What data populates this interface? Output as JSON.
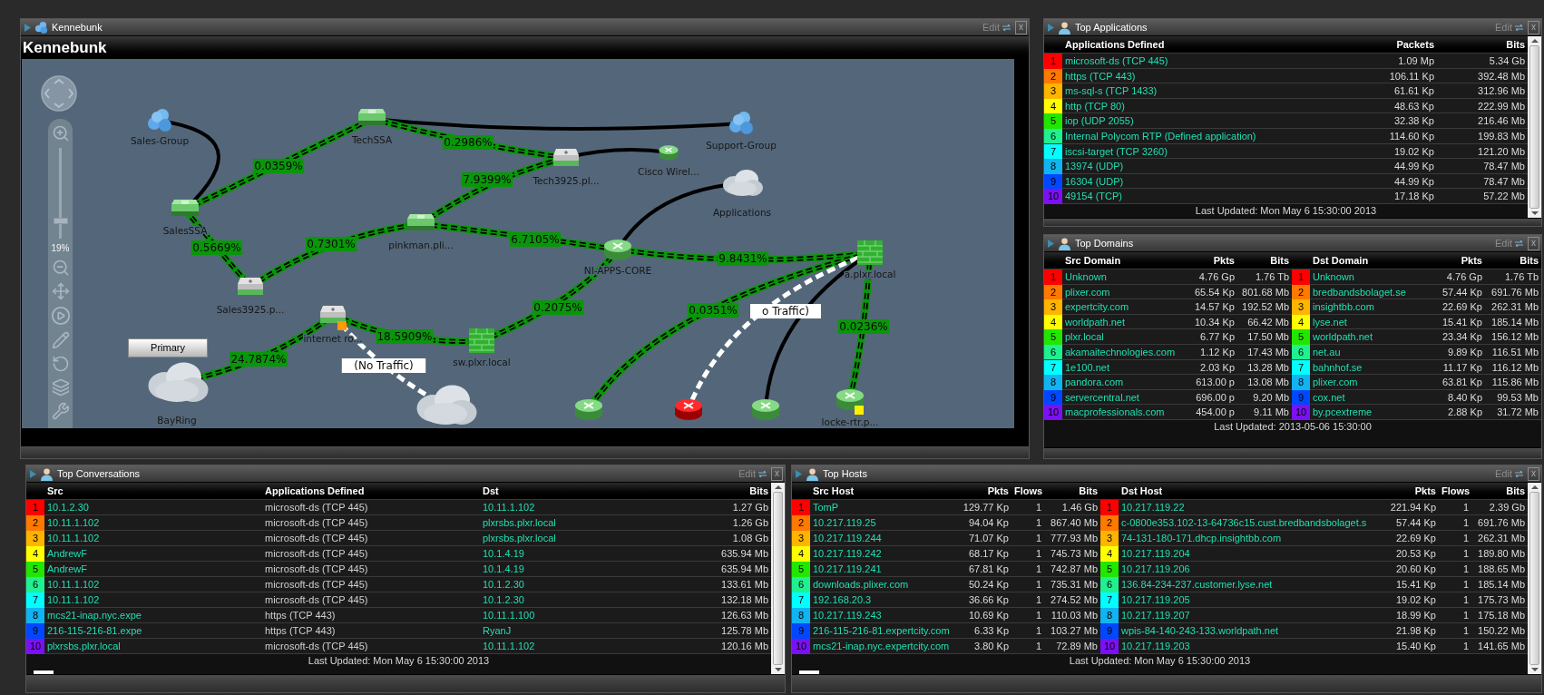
{
  "map_panel": {
    "title": "Kennebunk",
    "edit": "Edit",
    "close": "x",
    "heading": "Kennebunk",
    "zoom": {
      "level": 0.19,
      "reading": "19%"
    },
    "primary_button": "Primary",
    "nodes": [
      {
        "name": "Sales-Group",
        "kind": "group"
      },
      {
        "name": "TechSSA",
        "kind": "switch"
      },
      {
        "name": "Support-Group",
        "kind": "group"
      },
      {
        "name": "Tech3925.pl...",
        "kind": "appliance"
      },
      {
        "name": "Cisco Wirel...",
        "kind": "router",
        "down": false
      },
      {
        "name": "Applications",
        "kind": "cloud"
      },
      {
        "name": "SalesSSA",
        "kind": "switch"
      },
      {
        "name": "pinkman.pli...",
        "kind": "switch"
      },
      {
        "name": "NI-APPS-CORE",
        "kind": "router",
        "down": false
      },
      {
        "name": "a.plxr.local",
        "kind": "firewall"
      },
      {
        "name": "Sales3925.p...",
        "kind": "appliance"
      },
      {
        "name": "internet ro...",
        "kind": "appliance",
        "color": "#ff9900"
      },
      {
        "name": "sw.plxr.local",
        "kind": "firewall"
      },
      {
        "name": "BayRing",
        "kind": "cloud"
      },
      {
        "kind": "cloud"
      },
      {
        "kind": "router",
        "down": false
      },
      {
        "kind": "router",
        "down": true
      },
      {
        "kind": "router",
        "down": false
      },
      {
        "name": "locke-rtr.p...",
        "kind": "router",
        "down": false,
        "color": "#ffee00"
      }
    ],
    "links": [
      {
        "kind": "plain"
      },
      {
        "kind": "traffic",
        "label": "0.0359%"
      },
      {
        "kind": "plain"
      },
      {
        "kind": "traffic",
        "label": "0.2986%"
      },
      {
        "kind": "plain"
      },
      {
        "kind": "traffic",
        "label": "7.9399%"
      },
      {
        "kind": "traffic",
        "label": "0.5669%"
      },
      {
        "kind": "traffic",
        "label": "0.7301%"
      },
      {
        "kind": "traffic",
        "label": "6.7105%"
      },
      {
        "kind": "plain"
      },
      {
        "kind": "traffic",
        "label": "9.8431%"
      },
      {
        "kind": "traffic",
        "label": "0.2075%"
      },
      {
        "kind": "traffic",
        "label": "18.5909%"
      },
      {
        "kind": "traffic",
        "label": "24.7874%"
      },
      {
        "kind": "none",
        "label": "(No Traffic)"
      },
      {
        "kind": "traffic",
        "label": "0.0351%"
      },
      {
        "kind": "none",
        "label": "o Traffic)"
      },
      {
        "kind": "plain"
      },
      {
        "kind": "traffic",
        "label": "0.0236%"
      }
    ]
  },
  "top_applications": {
    "title": "Top Applications",
    "edit": "Edit",
    "close": "x",
    "columns": [
      "Applications Defined",
      "Packets",
      "Bits"
    ],
    "rows": [
      {
        "rank": "1",
        "color": "#ff0000",
        "name": "microsoft-ds (TCP 445)",
        "packets": "1.09 Mp",
        "bits": "5.34 Gb"
      },
      {
        "rank": "2",
        "color": "#ff7800",
        "name": "https (TCP 443)",
        "packets": "106.11 Kp",
        "bits": "392.48 Mb"
      },
      {
        "rank": "3",
        "color": "#ffb400",
        "name": "ms-sql-s (TCP 1433)",
        "packets": "61.61 Kp",
        "bits": "312.96 Mb"
      },
      {
        "rank": "4",
        "color": "#ffff00",
        "name": "http (TCP 80)",
        "packets": "48.63 Kp",
        "bits": "222.99 Mb"
      },
      {
        "rank": "5",
        "color": "#22e600",
        "name": "iop (UDP 2055)",
        "packets": "32.38 Kp",
        "bits": "216.46 Mb"
      },
      {
        "rank": "6",
        "color": "#20f090",
        "name": "Internal Polycom RTP (Defined application)",
        "packets": "114.60 Kp",
        "bits": "199.83 Mb"
      },
      {
        "rank": "7",
        "color": "#00ffff",
        "name": "iscsi-target (TCP 3260)",
        "packets": "19.02 Kp",
        "bits": "121.20 Mb"
      },
      {
        "rank": "8",
        "color": "#10b4f0",
        "name": "13974 (UDP)",
        "packets": "44.99 Kp",
        "bits": "78.47 Mb"
      },
      {
        "rank": "9",
        "color": "#0048ff",
        "name": "16304 (UDP)",
        "packets": "44.99 Kp",
        "bits": "78.47 Mb"
      },
      {
        "rank": "10",
        "color": "#7c10f4",
        "name": "49154 (TCP)",
        "packets": "17.18 Kp",
        "bits": "57.22 Mb"
      }
    ],
    "footer": "Last Updated: Mon May 6 15:30:00 2013"
  },
  "top_domains": {
    "title": "Top Domains",
    "edit": "Edit",
    "close": "x",
    "columns": [
      "Src Domain",
      "Pkts",
      "Bits",
      "Dst Domain",
      "Pkts",
      "Bits"
    ],
    "rows": [
      {
        "src": {
          "rank": "1",
          "color": "#ff0000",
          "domain": "Unknown",
          "pkts": "4.76 Gp",
          "bits": "1.76 Tb"
        },
        "dst": {
          "rank": "1",
          "color": "#ff0000",
          "domain": "Unknown",
          "pkts": "4.76 Gp",
          "bits": "1.76 Tb"
        }
      },
      {
        "src": {
          "rank": "2",
          "color": "#ff7800",
          "domain": "plixer.com",
          "pkts": "65.54 Kp",
          "bits": "801.68 Mb"
        },
        "dst": {
          "rank": "2",
          "color": "#ff7800",
          "domain": "bredbandsbolaget.se",
          "pkts": "57.44 Kp",
          "bits": "691.76 Mb"
        }
      },
      {
        "src": {
          "rank": "3",
          "color": "#ffb400",
          "domain": "expertcity.com",
          "pkts": "14.57 Kp",
          "bits": "192.52 Mb"
        },
        "dst": {
          "rank": "3",
          "color": "#ffb400",
          "domain": "insightbb.com",
          "pkts": "22.69 Kp",
          "bits": "262.31 Mb"
        }
      },
      {
        "src": {
          "rank": "4",
          "color": "#ffff00",
          "domain": "worldpath.net",
          "pkts": "10.34 Kp",
          "bits": "66.42 Mb"
        },
        "dst": {
          "rank": "4",
          "color": "#ffff00",
          "domain": "lyse.net",
          "pkts": "15.41 Kp",
          "bits": "185.14 Mb"
        }
      },
      {
        "src": {
          "rank": "5",
          "color": "#22e600",
          "domain": "plxr.local",
          "pkts": "6.77 Kp",
          "bits": "17.50 Mb"
        },
        "dst": {
          "rank": "5",
          "color": "#22e600",
          "domain": "worldpath.net",
          "pkts": "23.34 Kp",
          "bits": "156.12 Mb"
        }
      },
      {
        "src": {
          "rank": "6",
          "color": "#20f090",
          "domain": "akamaitechnologies.com",
          "pkts": "1.12 Kp",
          "bits": "17.43 Mb"
        },
        "dst": {
          "rank": "6",
          "color": "#20f090",
          "domain": "net.au",
          "pkts": "9.89 Kp",
          "bits": "116.51 Mb"
        }
      },
      {
        "src": {
          "rank": "7",
          "color": "#00ffff",
          "domain": "1e100.net",
          "pkts": "2.03 Kp",
          "bits": "13.28 Mb"
        },
        "dst": {
          "rank": "7",
          "color": "#00ffff",
          "domain": "bahnhof.se",
          "pkts": "11.17 Kp",
          "bits": "116.12 Mb"
        }
      },
      {
        "src": {
          "rank": "8",
          "color": "#10b4f0",
          "domain": "pandora.com",
          "pkts": "613.00 p",
          "bits": "13.08 Mb"
        },
        "dst": {
          "rank": "8",
          "color": "#10b4f0",
          "domain": "plixer.com",
          "pkts": "63.81 Kp",
          "bits": "115.86 Mb"
        }
      },
      {
        "src": {
          "rank": "9",
          "color": "#0048ff",
          "domain": "servercentral.net",
          "pkts": "696.00 p",
          "bits": "9.20 Mb"
        },
        "dst": {
          "rank": "9",
          "color": "#0048ff",
          "domain": "cox.net",
          "pkts": "8.40 Kp",
          "bits": "99.53 Mb"
        }
      },
      {
        "src": {
          "rank": "10",
          "color": "#7c10f4",
          "domain": "macprofessionals.com",
          "pkts": "454.00 p",
          "bits": "9.11 Mb"
        },
        "dst": {
          "rank": "10",
          "color": "#7c10f4",
          "domain": "by.pcextreme",
          "pkts": "2.88 Kp",
          "bits": "31.72 Mb"
        }
      }
    ],
    "footer": "Last Updated: 2013-05-06 15:30:00"
  },
  "top_conversations": {
    "title": "Top Conversations",
    "edit": "Edit",
    "close": "x",
    "columns": [
      "Src",
      "Applications Defined",
      "Dst",
      "Bits"
    ],
    "rows": [
      {
        "rank": "1",
        "color": "#ff0000",
        "src": "10.1.2.30",
        "application": "microsoft-ds (TCP 445)",
        "dst": "10.11.1.102",
        "bits": "1.27 Gb"
      },
      {
        "rank": "2",
        "color": "#ff7800",
        "src": "10.11.1.102",
        "application": "microsoft-ds (TCP 445)",
        "dst": "plxrsbs.plxr.local",
        "bits": "1.26 Gb"
      },
      {
        "rank": "3",
        "color": "#ffb400",
        "src": "10.11.1.102",
        "application": "microsoft-ds (TCP 445)",
        "dst": "plxrsbs.plxr.local",
        "bits": "1.08 Gb"
      },
      {
        "rank": "4",
        "color": "#ffff00",
        "src": "AndrewF",
        "application": "microsoft-ds (TCP 445)",
        "dst": "10.1.4.19",
        "bits": "635.94 Mb"
      },
      {
        "rank": "5",
        "color": "#22e600",
        "src": "AndrewF",
        "application": "microsoft-ds (TCP 445)",
        "dst": "10.1.4.19",
        "bits": "635.94 Mb"
      },
      {
        "rank": "6",
        "color": "#20f090",
        "src": "10.11.1.102",
        "application": "microsoft-ds (TCP 445)",
        "dst": "10.1.2.30",
        "bits": "133.61 Mb"
      },
      {
        "rank": "7",
        "color": "#00ffff",
        "src": "10.11.1.102",
        "application": "microsoft-ds (TCP 445)",
        "dst": "10.1.2.30",
        "bits": "132.18 Mb"
      },
      {
        "rank": "8",
        "color": "#10b4f0",
        "src": "mcs21-inap.nyc.expe",
        "application": "https (TCP 443)",
        "dst": "10.11.1.100",
        "bits": "126.63 Mb"
      },
      {
        "rank": "9",
        "color": "#0048ff",
        "src": "216-115-216-81.expe",
        "application": "https (TCP 443)",
        "dst": "RyanJ",
        "bits": "125.78 Mb"
      },
      {
        "rank": "10",
        "color": "#7c10f4",
        "src": "plxrsbs.plxr.local",
        "application": "microsoft-ds (TCP 445)",
        "dst": "10.11.1.102",
        "bits": "120.16 Mb"
      }
    ],
    "footer": "Last Updated: Mon May 6 15:30:00 2013"
  },
  "top_hosts": {
    "title": "Top Hosts",
    "edit": "Edit",
    "close": "x",
    "columns": [
      "Src Host",
      "Pkts",
      "Flows",
      "Bits",
      "Dst Host",
      "Pkts",
      "Flows",
      "Bits"
    ],
    "rows": [
      {
        "src": {
          "rank": "1",
          "color": "#ff0000",
          "host": "TomP",
          "pkts": "129.77 Kp",
          "flows": "1",
          "bits": "1.46 Gb"
        },
        "dst": {
          "rank": "1",
          "color": "#ff0000",
          "host": "10.217.119.22",
          "pkts": "221.94 Kp",
          "flows": "1",
          "bits": "2.39 Gb"
        }
      },
      {
        "src": {
          "rank": "2",
          "color": "#ff7800",
          "host": "10.217.119.25",
          "pkts": "94.04 Kp",
          "flows": "1",
          "bits": "867.40 Mb"
        },
        "dst": {
          "rank": "2",
          "color": "#ff7800",
          "host": "c-0800e353.102-13-64736c15.cust.bredbandsbolaget.s",
          "pkts": "57.44 Kp",
          "flows": "1",
          "bits": "691.76 Mb"
        }
      },
      {
        "src": {
          "rank": "3",
          "color": "#ffb400",
          "host": "10.217.119.244",
          "pkts": "71.07 Kp",
          "flows": "1",
          "bits": "777.93 Mb"
        },
        "dst": {
          "rank": "3",
          "color": "#ffb400",
          "host": "74-131-180-171.dhcp.insightbb.com",
          "pkts": "22.69 Kp",
          "flows": "1",
          "bits": "262.31 Mb"
        }
      },
      {
        "src": {
          "rank": "4",
          "color": "#ffff00",
          "host": "10.217.119.242",
          "pkts": "68.17 Kp",
          "flows": "1",
          "bits": "745.73 Mb"
        },
        "dst": {
          "rank": "4",
          "color": "#ffff00",
          "host": "10.217.119.204",
          "pkts": "20.53 Kp",
          "flows": "1",
          "bits": "189.80 Mb"
        }
      },
      {
        "src": {
          "rank": "5",
          "color": "#22e600",
          "host": "10.217.119.241",
          "pkts": "67.81 Kp",
          "flows": "1",
          "bits": "742.87 Mb"
        },
        "dst": {
          "rank": "5",
          "color": "#22e600",
          "host": "10.217.119.206",
          "pkts": "20.60 Kp",
          "flows": "1",
          "bits": "188.65 Mb"
        }
      },
      {
        "src": {
          "rank": "6",
          "color": "#20f090",
          "host": "downloads.plixer.com",
          "pkts": "50.24 Kp",
          "flows": "1",
          "bits": "735.31 Mb"
        },
        "dst": {
          "rank": "6",
          "color": "#20f090",
          "host": "136.84-234-237.customer.lyse.net",
          "pkts": "15.41 Kp",
          "flows": "1",
          "bits": "185.14 Mb"
        }
      },
      {
        "src": {
          "rank": "7",
          "color": "#00ffff",
          "host": "192.168.20.3",
          "pkts": "36.66 Kp",
          "flows": "1",
          "bits": "274.52 Mb"
        },
        "dst": {
          "rank": "7",
          "color": "#00ffff",
          "host": "10.217.119.205",
          "pkts": "19.02 Kp",
          "flows": "1",
          "bits": "175.73 Mb"
        }
      },
      {
        "src": {
          "rank": "8",
          "color": "#10b4f0",
          "host": "10.217.119.243",
          "pkts": "10.69 Kp",
          "flows": "1",
          "bits": "110.03 Mb"
        },
        "dst": {
          "rank": "8",
          "color": "#10b4f0",
          "host": "10.217.119.207",
          "pkts": "18.99 Kp",
          "flows": "1",
          "bits": "175.18 Mb"
        }
      },
      {
        "src": {
          "rank": "9",
          "color": "#0048ff",
          "host": "216-115-216-81.expertcity.com",
          "pkts": "6.33 Kp",
          "flows": "1",
          "bits": "103.27 Mb"
        },
        "dst": {
          "rank": "9",
          "color": "#0048ff",
          "host": "wpis-84-140-243-133.worldpath.net",
          "pkts": "21.98 Kp",
          "flows": "1",
          "bits": "150.22 Mb"
        }
      },
      {
        "src": {
          "rank": "10",
          "color": "#7c10f4",
          "host": "mcs21-inap.nyc.expertcity.com",
          "pkts": "3.80 Kp",
          "flows": "1",
          "bits": "72.89 Mb"
        },
        "dst": {
          "rank": "10",
          "color": "#7c10f4",
          "host": "10.217.119.203",
          "pkts": "15.40 Kp",
          "flows": "1",
          "bits": "141.65 Mb"
        }
      }
    ],
    "footer": "Last Updated: Mon May 6 15:30:00 2013"
  }
}
